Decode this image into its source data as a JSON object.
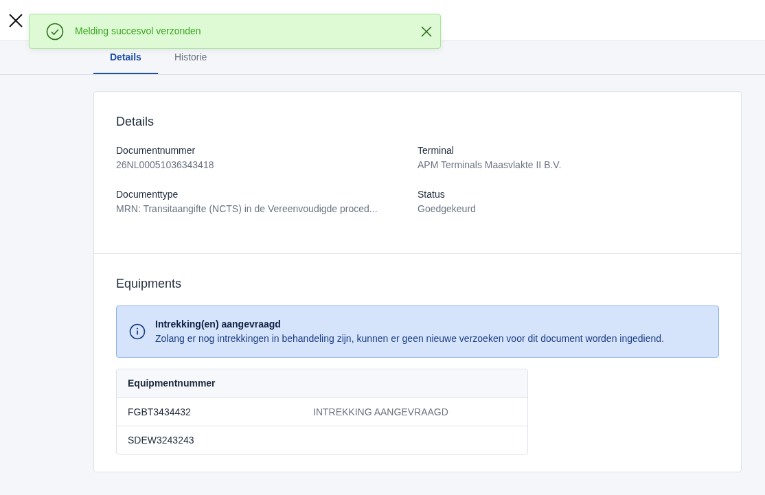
{
  "toast": {
    "message": "Melding succesvol verzonden"
  },
  "tabs": [
    {
      "label": "Details",
      "selected": true
    },
    {
      "label": "Historie",
      "selected": false
    }
  ],
  "details": {
    "heading": "Details",
    "fields": [
      {
        "label": "Documentnummer",
        "value": "26NL00051036343418"
      },
      {
        "label": "Terminal",
        "value": "APM Terminals Maasvlakte II B.V."
      },
      {
        "label": "Documenttype",
        "value": "MRN: Transitaangifte (NCTS) in de Vereenvoudigde proced..."
      },
      {
        "label": "Status",
        "value": "Goedgekeurd"
      }
    ]
  },
  "equipments": {
    "heading": "Equipments",
    "alert": {
      "title": "Intrekking(en) aangevraagd",
      "text": "Zolang er nog intrekkingen in behandeling zijn, kunnen er geen nieuwe verzoeken voor dit document worden ingediend."
    },
    "table": {
      "columns": [
        "Equipmentnummer"
      ],
      "rows": [
        {
          "number": "FGBT3434432",
          "status": "INTREKKING AANGEVRAAGD"
        },
        {
          "number": "SDEW3243243"
        }
      ]
    }
  }
}
